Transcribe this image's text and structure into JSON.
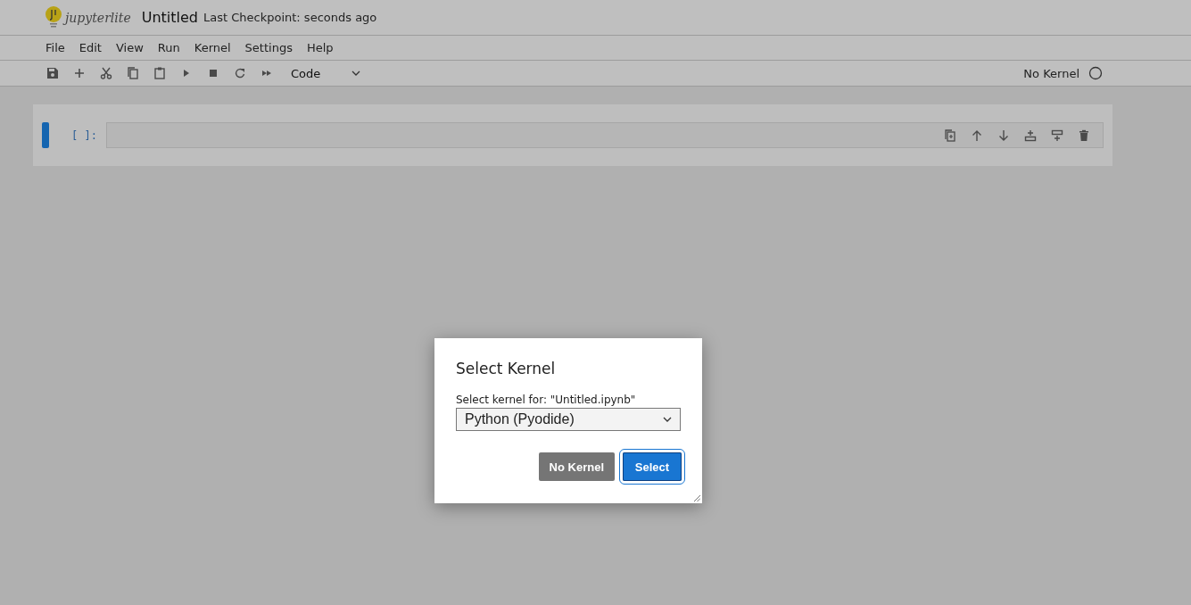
{
  "header": {
    "logo_text": "jupyterlite",
    "document_title": "Untitled",
    "checkpoint": "Last Checkpoint: seconds ago"
  },
  "menu": [
    "File",
    "Edit",
    "View",
    "Run",
    "Kernel",
    "Settings",
    "Help"
  ],
  "toolbar": {
    "cell_type": "Code",
    "kernel_name": "No Kernel",
    "kernel_busy": false
  },
  "cell": {
    "prompt": "[ ]:",
    "active": true
  },
  "dialog": {
    "title": "Select Kernel",
    "label": "Select kernel for: \"Untitled.ipynb\"",
    "selected_kernel": "Python (Pyodide)",
    "buttons": [
      {
        "label": "No Kernel",
        "kind": "secondary",
        "focused": false
      },
      {
        "label": "Select",
        "kind": "primary",
        "focused": true
      }
    ]
  }
}
